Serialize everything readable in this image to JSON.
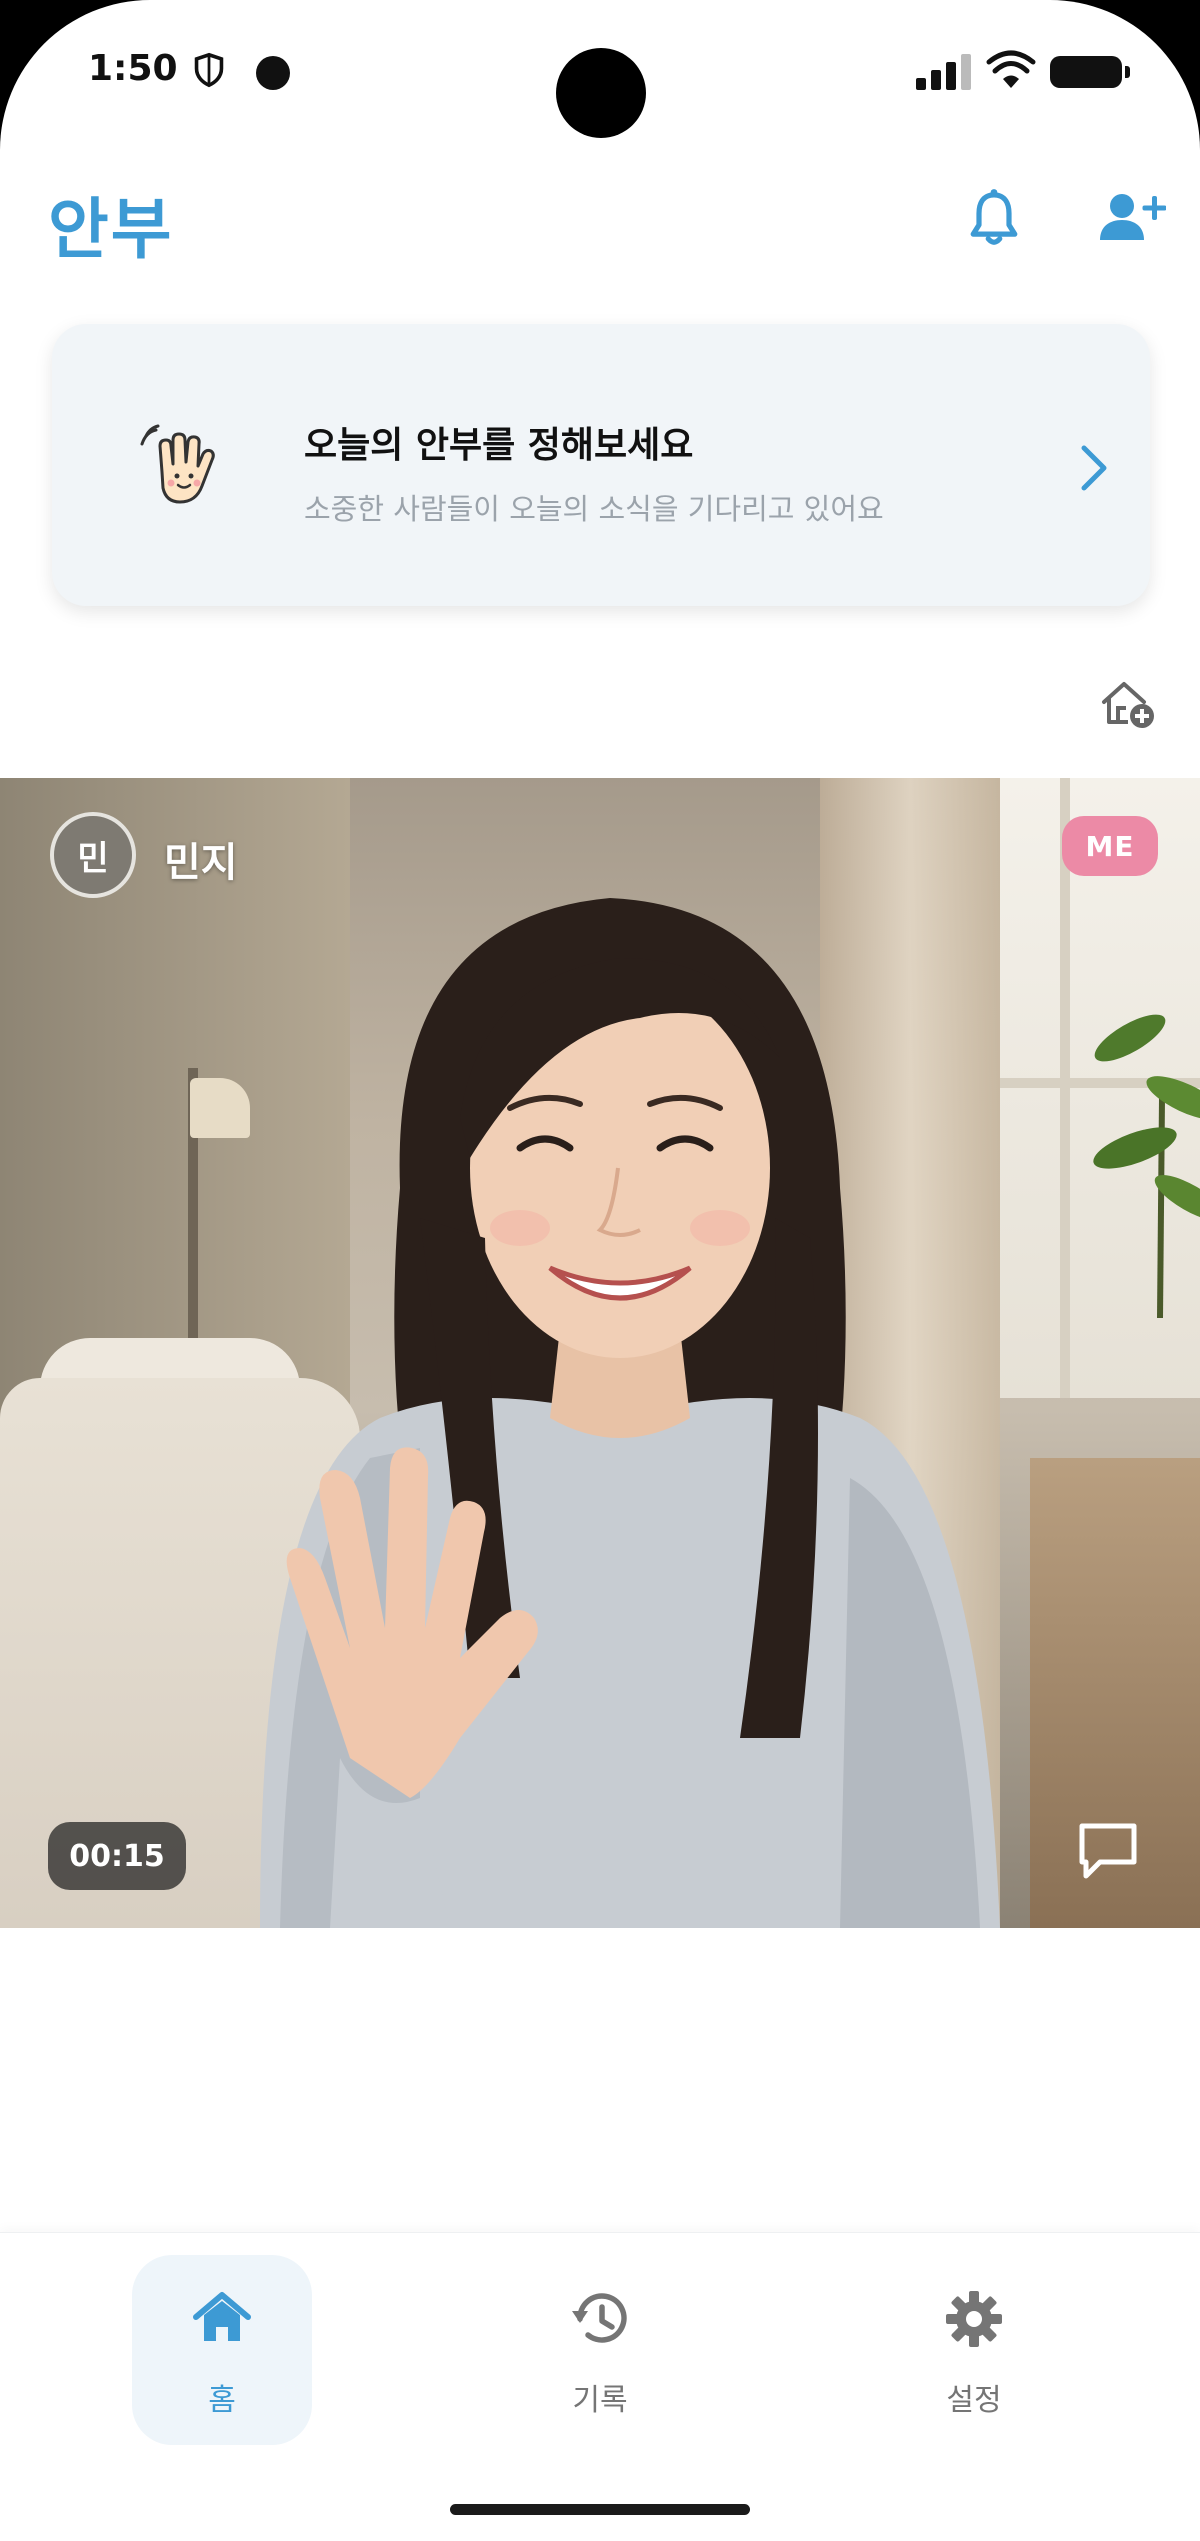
{
  "status_bar": {
    "time": "1:50"
  },
  "app": {
    "title": "안부"
  },
  "banner": {
    "title": "오늘의 안부를 정해보세요",
    "subtitle": "소중한 사람들이 오늘의 소식을 기다리고 있어요"
  },
  "video_card": {
    "avatar_initial": "민",
    "user_name": "민지",
    "badge": "ME",
    "duration": "00:15"
  },
  "bottom_nav": {
    "items": [
      {
        "label": "홈",
        "icon": "home-icon",
        "active": true
      },
      {
        "label": "기록",
        "icon": "history-icon",
        "active": false
      },
      {
        "label": "설정",
        "icon": "gear-icon",
        "active": false
      }
    ]
  },
  "colors": {
    "accent": "#3d9ad4",
    "badge": "#ec8aa6",
    "muted_icon": "#757575"
  }
}
